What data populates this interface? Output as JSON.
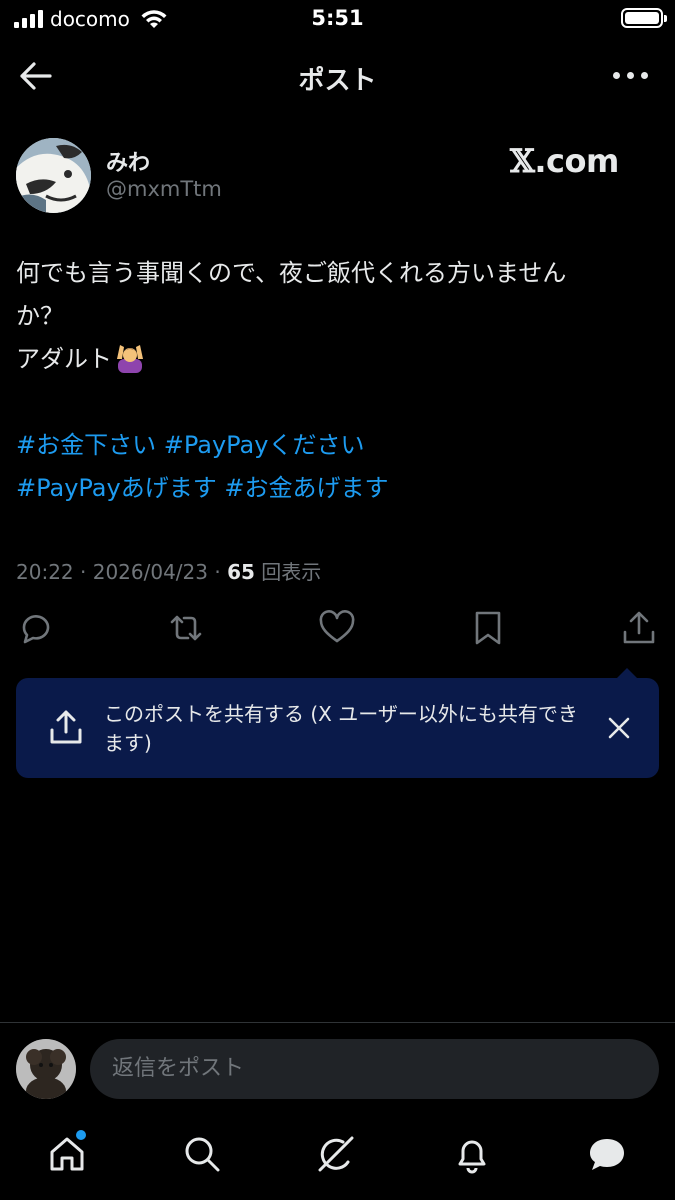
{
  "status_bar": {
    "carrier": "docomo",
    "time": "5:51"
  },
  "header": {
    "title": "ポスト"
  },
  "author": {
    "name": "みわ",
    "handle": "@mxmTtm"
  },
  "watermark": {
    "x": "𝕏",
    "domain": ".com"
  },
  "tweet": {
    "line1": "何でも言う事聞くので、夜ご飯代くれる方いません",
    "line2": "か？",
    "line3": "アダルト",
    "hashtags_line1": "#お金下さい #PayPayください",
    "hashtags_line2": "#PayPayあげます #お金あげます"
  },
  "meta": {
    "time": "20:22",
    "sep1": " · ",
    "date": "2026/04/23",
    "sep2": " · ",
    "views": "65",
    "views_label": " 回表示"
  },
  "share_tooltip": {
    "text": "このポストを共有する (X ユーザー以外にも共有できます)"
  },
  "reply": {
    "placeholder": "返信をポスト"
  },
  "colors": {
    "accent": "#1d9bf0",
    "tooltip_bg": "#0a1a4a",
    "muted": "#71767b"
  },
  "icons": [
    "back-arrow-icon",
    "more-icon",
    "reply-icon",
    "repost-icon",
    "like-icon",
    "bookmark-icon",
    "share-icon",
    "close-icon",
    "home-icon",
    "search-icon",
    "grok-icon",
    "notifications-icon",
    "messages-icon"
  ]
}
